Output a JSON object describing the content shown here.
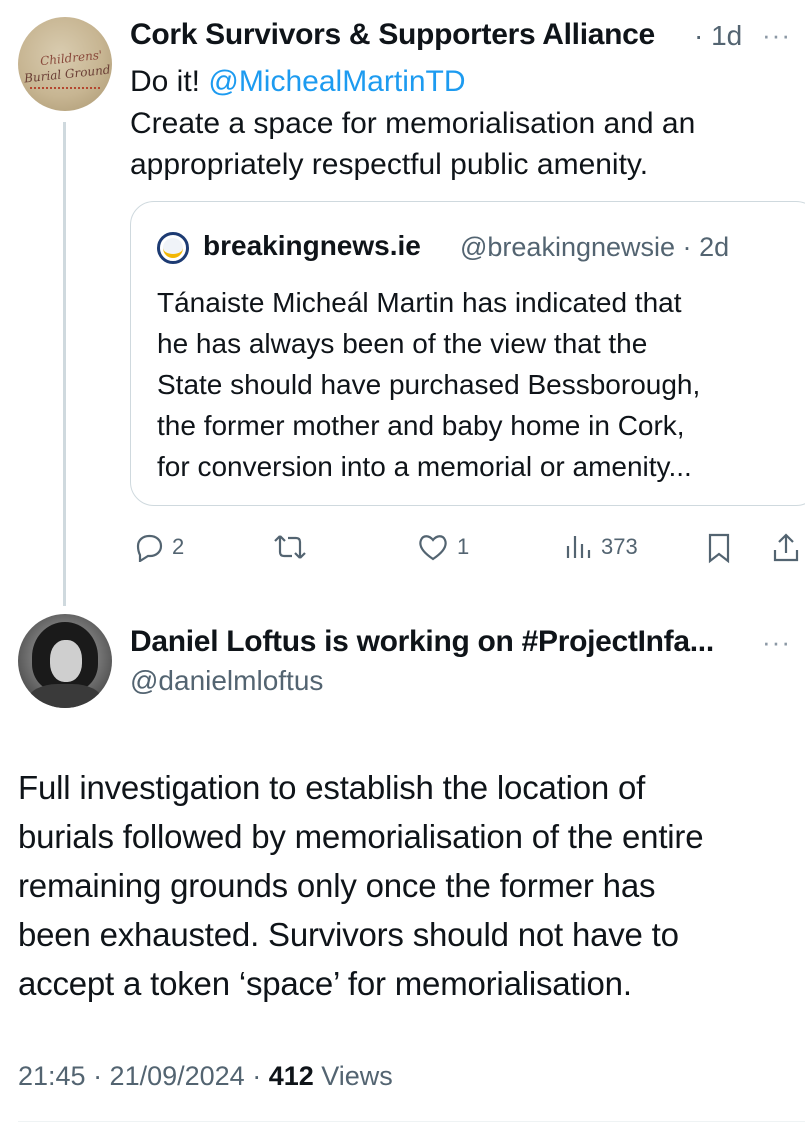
{
  "parent_tweet": {
    "author_name": "Cork Survivors & Supporters Alliance",
    "time_sep": "·",
    "time": "1d",
    "more": "···",
    "avatar_text_line1": "Childrens'",
    "avatar_text_line2": "Burial Ground",
    "text_line1_prefix": "Do it! ",
    "text_line1_mention": "@MichealMartinTD",
    "text_line2": "Create a space for memorialisation and an",
    "text_line3": "appropriately respectful public amenity."
  },
  "quoted_tweet": {
    "author_name": "breakingnews.ie",
    "handle": "@breakingnewsie",
    "time_sep": "·",
    "time": "2d",
    "lines": [
      "Tánaiste Micheál Martin has indicated that",
      "he has always been of the view that the",
      "State should have purchased Bessborough,",
      "the former mother and baby home in Cork,",
      "for conversion into a memorial or amenity..."
    ]
  },
  "actions": {
    "replies": "2",
    "likes": "1",
    "views": "373"
  },
  "reply_tweet": {
    "author_name": "Daniel Loftus is working on #ProjectInfa...",
    "handle": "@danielmloftus",
    "more": "···",
    "lines": [
      "Full investigation to establish the location of",
      "burials followed by memorialisation of the entire",
      "remaining grounds only once the former has",
      "been exhausted. Survivors should not have to",
      "accept a token ‘space’ for memorialisation."
    ],
    "timestamp": "21:45 · 21/09/2024 · ",
    "views_count": "412",
    "views_label": " Views"
  },
  "colors": {
    "accent": "#1d9bf0",
    "text": "#0f1419",
    "muted": "#536471",
    "border": "#cfd9de"
  },
  "icons": [
    "reply-icon",
    "retweet-icon",
    "like-icon",
    "views-icon",
    "bookmark-icon",
    "share-icon",
    "more-icon"
  ]
}
